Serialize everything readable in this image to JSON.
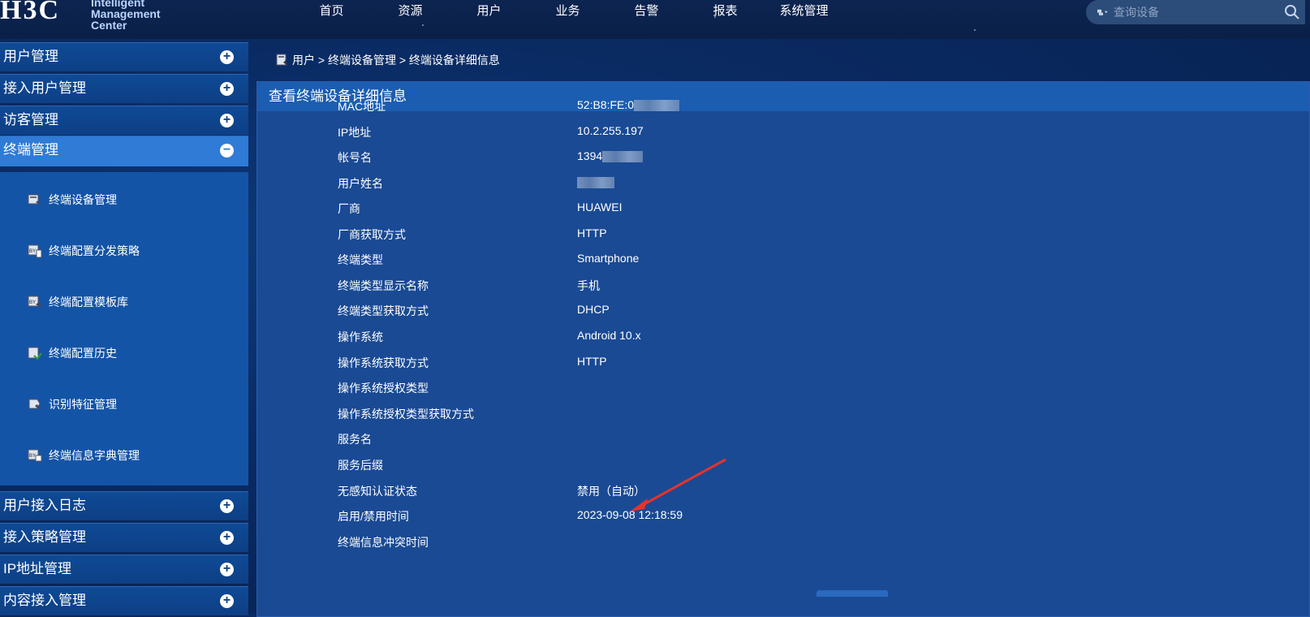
{
  "header": {
    "logo_mark": "H3C",
    "logo_line1": "Intelligent",
    "logo_line2": "Management Center",
    "nav": [
      "首页",
      "资源",
      "用户",
      "业务",
      "告警",
      "报表",
      "系统管理"
    ],
    "search_placeholder": "查询设备"
  },
  "sidebar": {
    "sections": [
      {
        "label": "用户管理"
      },
      {
        "label": "接入用户管理"
      },
      {
        "label": "访客管理"
      },
      {
        "label": "终端管理"
      },
      {
        "label": "用户接入日志"
      },
      {
        "label": "接入策略管理"
      },
      {
        "label": "IP地址管理"
      },
      {
        "label": "内容接入管理"
      }
    ],
    "sub_items": [
      {
        "label": "终端设备管理",
        "icon": "device-icon"
      },
      {
        "label": "终端配置分发策略",
        "icon": "byod-policy-icon"
      },
      {
        "label": "终端配置模板库",
        "icon": "byod-template-icon"
      },
      {
        "label": "终端配置历史",
        "icon": "history-icon"
      },
      {
        "label": "识别特征管理",
        "icon": "feature-icon"
      },
      {
        "label": "终端信息字典管理",
        "icon": "dictionary-icon"
      }
    ]
  },
  "breadcrumb": "用户 > 终端设备管理 > 终端设备详细信息",
  "panel": {
    "title": "查看终端设备详细信息",
    "fields": [
      {
        "k": "MAC地址",
        "v": "52:B8:FE:0"
      },
      {
        "k": "IP地址",
        "v": "10.2.255.197"
      },
      {
        "k": "帐号名",
        "v": "1394"
      },
      {
        "k": "用户姓名",
        "v": ""
      },
      {
        "k": "厂商",
        "v": "HUAWEI"
      },
      {
        "k": "厂商获取方式",
        "v": "HTTP"
      },
      {
        "k": "终端类型",
        "v": "Smartphone"
      },
      {
        "k": "终端类型显示名称",
        "v": "手机"
      },
      {
        "k": "终端类型获取方式",
        "v": "DHCP"
      },
      {
        "k": "操作系统",
        "v": "Android 10.x"
      },
      {
        "k": "操作系统获取方式",
        "v": "HTTP"
      },
      {
        "k": "操作系统授权类型",
        "v": ""
      },
      {
        "k": "操作系统授权类型获取方式",
        "v": ""
      },
      {
        "k": "服务名",
        "v": ""
      },
      {
        "k": "服务后缀",
        "v": ""
      },
      {
        "k": "无感知认证状态",
        "v": "禁用（自动）"
      },
      {
        "k": "启用/禁用时间",
        "v": "2023-09-08 12:18:59"
      },
      {
        "k": "终端信息冲突时间",
        "v": ""
      }
    ]
  },
  "colors": {
    "accent": "#2f7bd6",
    "panel": "#1a4a94",
    "arrow": "#e8322a"
  }
}
